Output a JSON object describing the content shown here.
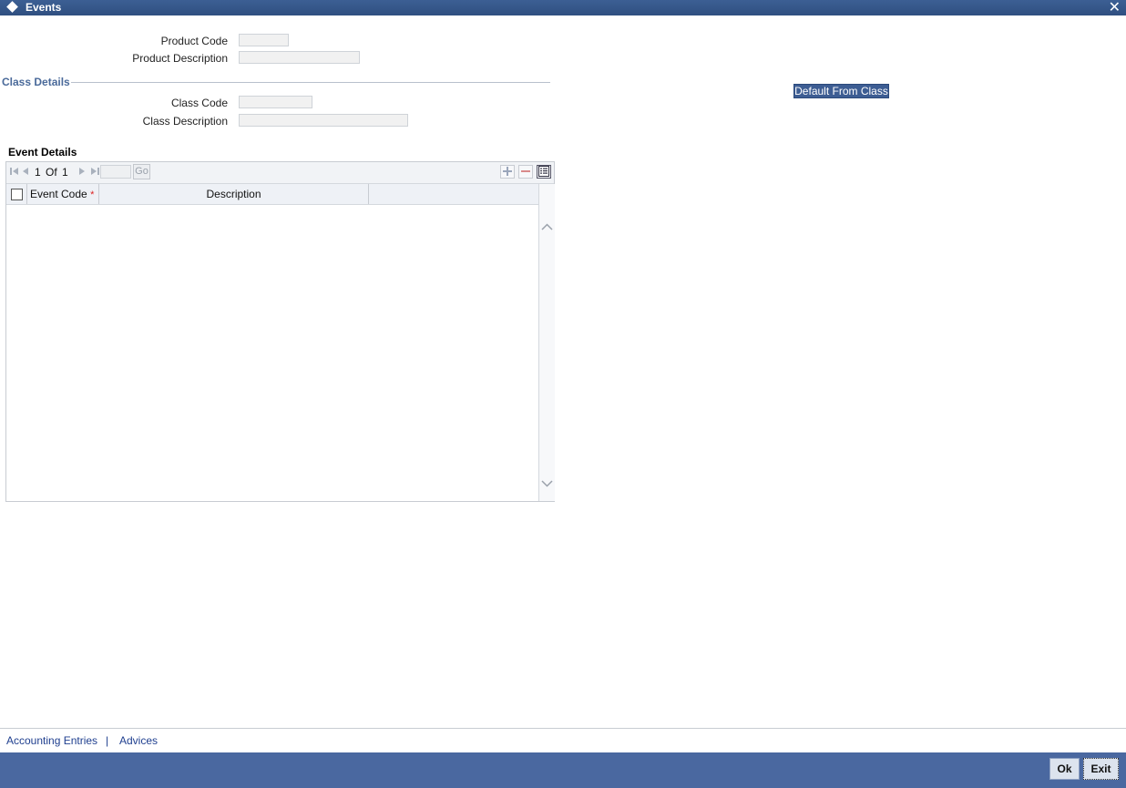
{
  "window": {
    "title": "Events"
  },
  "fields": {
    "product_code": {
      "label": "Product Code",
      "value": ""
    },
    "product_description": {
      "label": "Product Description",
      "value": ""
    },
    "class_code": {
      "label": "Class Code",
      "value": ""
    },
    "class_description": {
      "label": "Class Description",
      "value": ""
    }
  },
  "class_details": {
    "title": "Class Details"
  },
  "default_button": {
    "label": "Default From Class"
  },
  "event_details": {
    "title": "Event Details",
    "pagination": {
      "current": "1",
      "of": "Of",
      "total": "1",
      "go": "Go",
      "page_input": ""
    },
    "columns": {
      "event_code": "Event Code",
      "required_mark": "*",
      "description": "Description"
    },
    "rows": []
  },
  "bottom_links": {
    "accounting": "Accounting Entries",
    "separator": "|",
    "advices": "Advices"
  },
  "footer": {
    "ok": "Ok",
    "exit": "Exit"
  },
  "colors": {
    "titlebar": "#2f4f80",
    "footer": "#4a68a0",
    "link": "#1f3f8f",
    "section_title": "#4a6a9a",
    "required": "#dd2222"
  }
}
